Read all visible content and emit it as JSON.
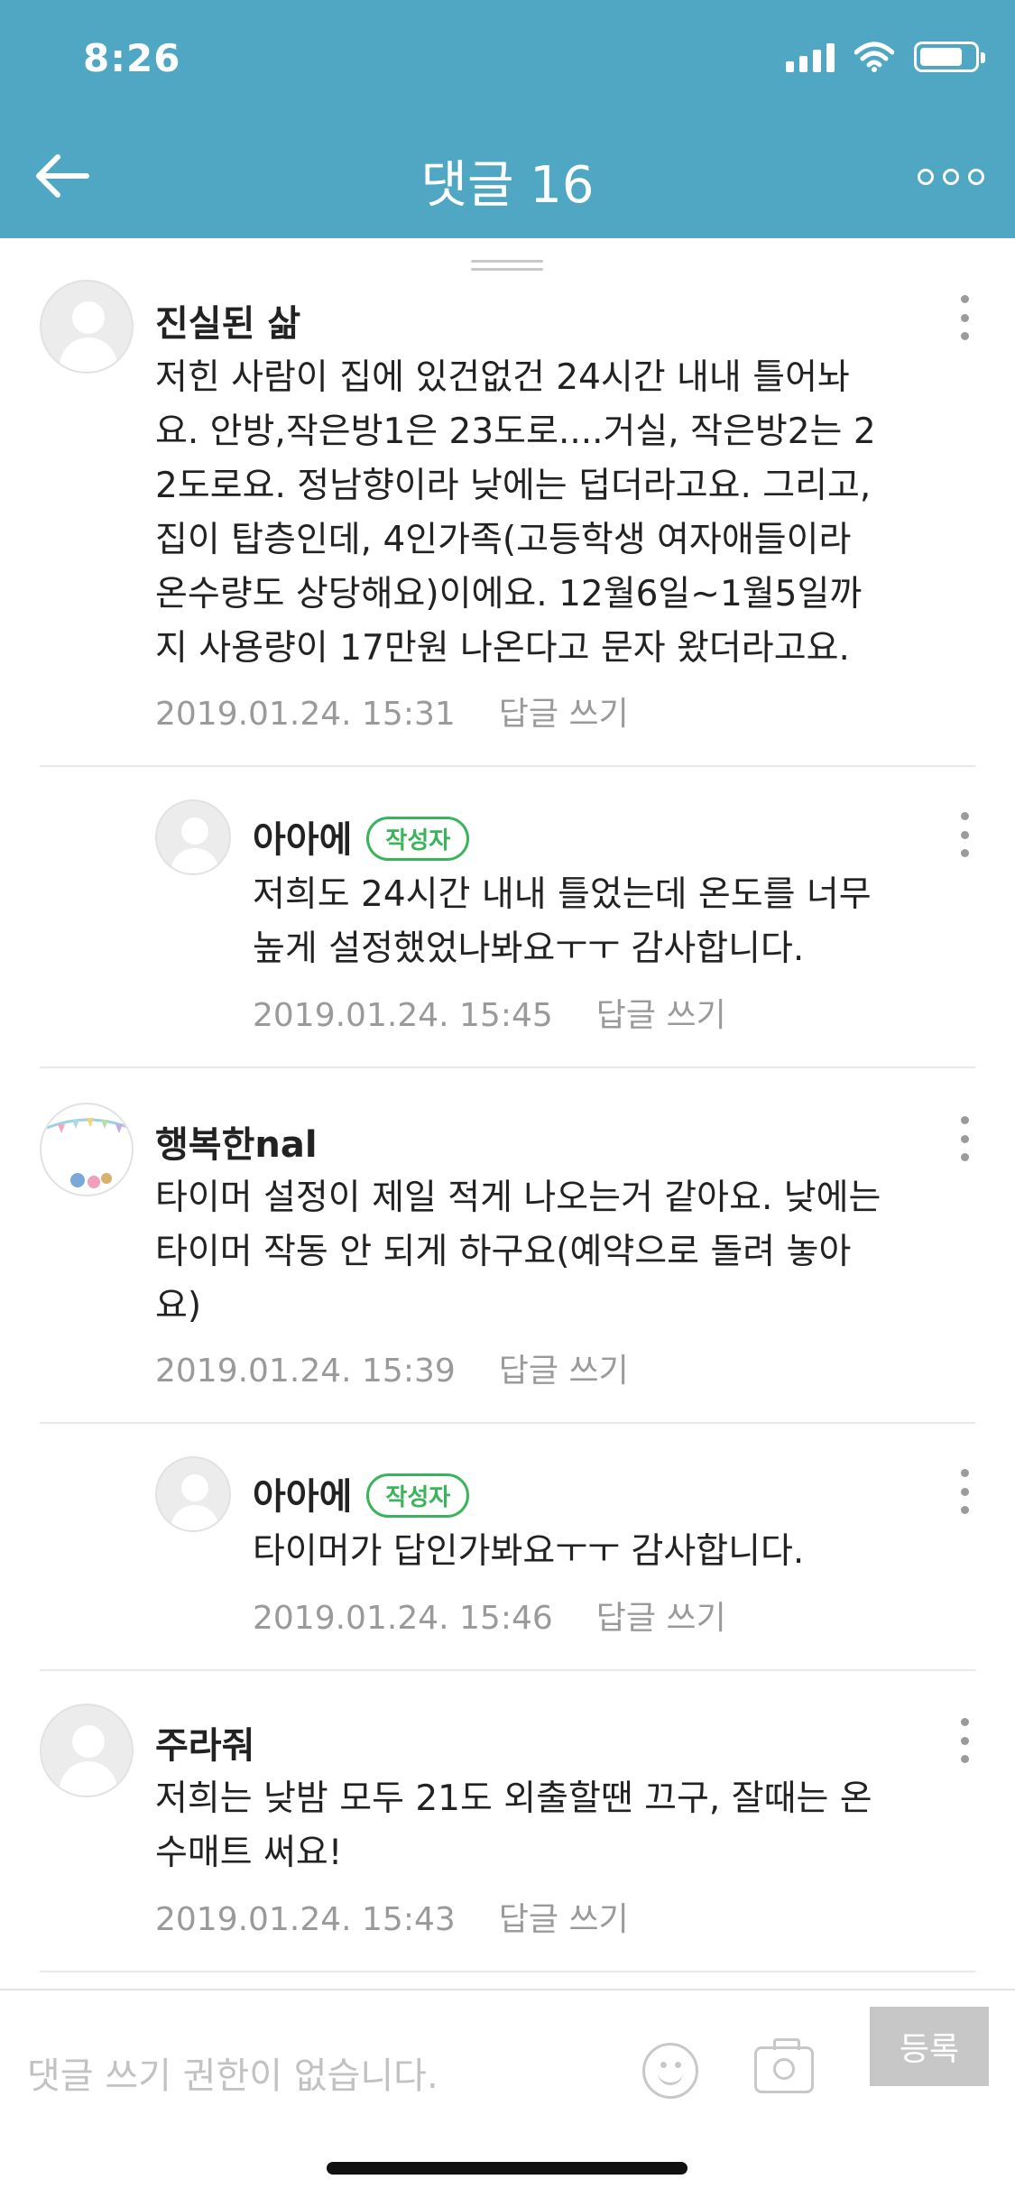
{
  "status_bar": {
    "time": "8:26"
  },
  "header": {
    "title": "댓글 16"
  },
  "comments": [
    {
      "author": "진실된 삶",
      "text": "저힌 사람이 집에 있건없건 24시간 내내 틀어놔\n요. 안방,작은방1은 23도로....거실, 작은방2는 2\n2도로요. 정남향이라 낮에는 덥더라고요. 그리고,\n집이 탑층인데, 4인가족(고등학생 여자애들이라\n온수량도 상당해요)이에요. 12월6일~1월5일까\n지 사용량이 17만원 나온다고 문자 왔더라고요.",
      "timestamp": "2019.01.24. 15:31",
      "reply_label": "답글 쓰기"
    },
    {
      "author": "아아에",
      "badge": "작성자",
      "text": "저희도 24시간 내내 틀었는데 온도를 너무\n높게 설정했었나봐요ㅜㅜ 감사합니다.",
      "timestamp": "2019.01.24. 15:45",
      "reply_label": "답글 쓰기"
    },
    {
      "author": "행복한nal",
      "text": "타이머 설정이 제일 적게 나오는거 같아요. 낮에는\n타이머 작동 안 되게 하구요(예약으로 돌려 놓아\n요)",
      "timestamp": "2019.01.24. 15:39",
      "reply_label": "답글 쓰기"
    },
    {
      "author": "아아에",
      "badge": "작성자",
      "text": "타이머가 답인가봐요ㅜㅜ 감사합니다.",
      "timestamp": "2019.01.24. 15:46",
      "reply_label": "답글 쓰기"
    },
    {
      "author": "주라줘",
      "text": "저희는 낮밤 모두 21도 외출할땐 끄구, 잘때는 온\n수매트 써요!",
      "timestamp": "2019.01.24. 15:43",
      "reply_label": "답글 쓰기"
    }
  ],
  "input": {
    "placeholder": "댓글 쓰기 권한이 없습니다.",
    "submit_label": "등록"
  },
  "colors": {
    "header_bg": "#4fa7c4",
    "author_badge": "#3ab45a"
  }
}
